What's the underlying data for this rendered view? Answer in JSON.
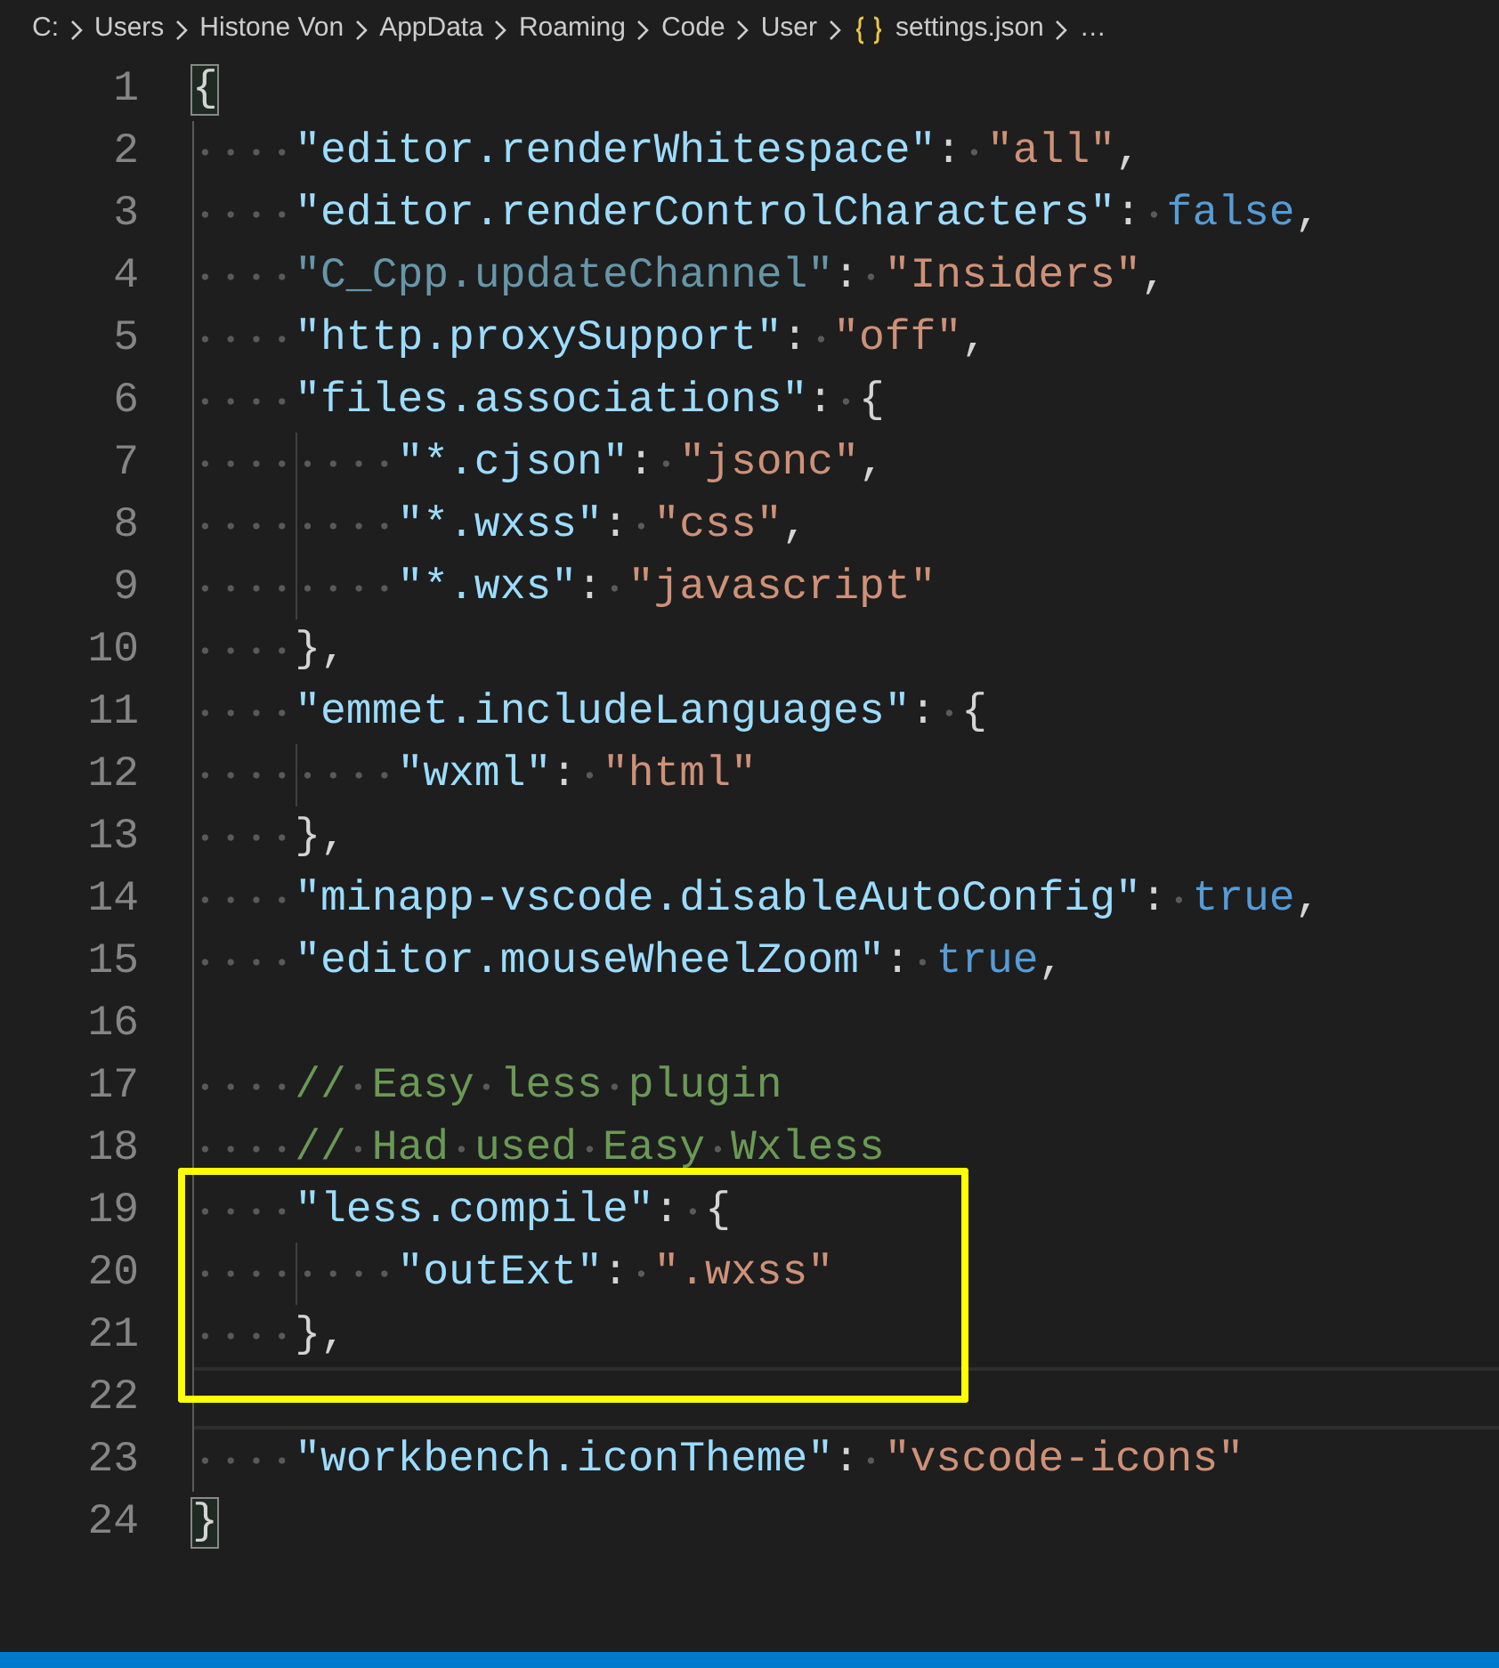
{
  "breadcrumb": [
    {
      "kind": "folder",
      "label": "C:"
    },
    {
      "kind": "folder",
      "label": "Users"
    },
    {
      "kind": "folder",
      "label": "Histone Von"
    },
    {
      "kind": "folder",
      "label": "AppData"
    },
    {
      "kind": "folder",
      "label": "Roaming"
    },
    {
      "kind": "folder",
      "label": "Code"
    },
    {
      "kind": "folder",
      "label": "User"
    },
    {
      "kind": "json_file",
      "label": "settings.json"
    },
    {
      "kind": "more",
      "label": "…"
    }
  ],
  "lines": [
    {
      "number": "1",
      "current": false,
      "boxed": false,
      "tokens": [
        {
          "kind": "bracket_match",
          "text": "{"
        }
      ]
    },
    {
      "number": "2",
      "current": false,
      "boxed": false,
      "tokens": [
        {
          "kind": "key",
          "text": "    \"editor.renderWhitespace\""
        },
        {
          "kind": "plain",
          "text": ": "
        },
        {
          "kind": "string",
          "text": "\"all\""
        },
        {
          "kind": "plain",
          "text": ","
        }
      ]
    },
    {
      "number": "3",
      "current": false,
      "boxed": false,
      "tokens": [
        {
          "kind": "key",
          "text": "    \"editor.renderControlCharacters\""
        },
        {
          "kind": "plain",
          "text": ": "
        },
        {
          "kind": "keyword",
          "text": "false"
        },
        {
          "kind": "plain",
          "text": ","
        }
      ]
    },
    {
      "number": "4",
      "current": false,
      "boxed": false,
      "tokens": [
        {
          "kind": "unknown_key",
          "text": "    \"C_Cpp.updateChannel\""
        },
        {
          "kind": "plain",
          "text": ": "
        },
        {
          "kind": "string",
          "text": "\"Insiders\""
        },
        {
          "kind": "plain",
          "text": ","
        }
      ]
    },
    {
      "number": "5",
      "current": false,
      "boxed": false,
      "tokens": [
        {
          "kind": "key",
          "text": "    \"http.proxySupport\""
        },
        {
          "kind": "plain",
          "text": ": "
        },
        {
          "kind": "string",
          "text": "\"off\""
        },
        {
          "kind": "plain",
          "text": ","
        }
      ]
    },
    {
      "number": "6",
      "current": false,
      "boxed": false,
      "tokens": [
        {
          "kind": "key",
          "text": "    \"files.associations\""
        },
        {
          "kind": "plain",
          "text": ": {"
        }
      ]
    },
    {
      "number": "7",
      "current": false,
      "boxed": false,
      "tokens": [
        {
          "kind": "key",
          "text": "        \"*.cjson\""
        },
        {
          "kind": "plain",
          "text": ": "
        },
        {
          "kind": "string",
          "text": "\"jsonc\""
        },
        {
          "kind": "plain",
          "text": ","
        }
      ]
    },
    {
      "number": "8",
      "current": false,
      "boxed": false,
      "tokens": [
        {
          "kind": "key",
          "text": "        \"*.wxss\""
        },
        {
          "kind": "plain",
          "text": ": "
        },
        {
          "kind": "string",
          "text": "\"css\""
        },
        {
          "kind": "plain",
          "text": ","
        }
      ]
    },
    {
      "number": "9",
      "current": false,
      "boxed": false,
      "tokens": [
        {
          "kind": "key",
          "text": "        \"*.wxs\""
        },
        {
          "kind": "plain",
          "text": ": "
        },
        {
          "kind": "string",
          "text": "\"javascript\""
        }
      ]
    },
    {
      "number": "10",
      "current": false,
      "boxed": false,
      "tokens": [
        {
          "kind": "plain",
          "text": "    },"
        }
      ]
    },
    {
      "number": "11",
      "current": false,
      "boxed": false,
      "tokens": [
        {
          "kind": "key",
          "text": "    \"emmet.includeLanguages\""
        },
        {
          "kind": "plain",
          "text": ": {"
        }
      ]
    },
    {
      "number": "12",
      "current": false,
      "boxed": false,
      "tokens": [
        {
          "kind": "key",
          "text": "        \"wxml\""
        },
        {
          "kind": "plain",
          "text": ": "
        },
        {
          "kind": "string",
          "text": "\"html\""
        }
      ]
    },
    {
      "number": "13",
      "current": false,
      "boxed": false,
      "tokens": [
        {
          "kind": "plain",
          "text": "    },"
        }
      ]
    },
    {
      "number": "14",
      "current": false,
      "boxed": false,
      "tokens": [
        {
          "kind": "key",
          "text": "    \"minapp-vscode.disableAutoConfig\""
        },
        {
          "kind": "plain",
          "text": ": "
        },
        {
          "kind": "keyword",
          "text": "true"
        },
        {
          "kind": "plain",
          "text": ","
        }
      ]
    },
    {
      "number": "15",
      "current": false,
      "boxed": false,
      "tokens": [
        {
          "kind": "key",
          "text": "    \"editor.mouseWheelZoom\""
        },
        {
          "kind": "plain",
          "text": ": "
        },
        {
          "kind": "keyword",
          "text": "true"
        },
        {
          "kind": "plain",
          "text": ","
        }
      ]
    },
    {
      "number": "16",
      "current": false,
      "boxed": false
    },
    {
      "number": "17",
      "current": false,
      "boxed": false,
      "tokens": [
        {
          "kind": "comment",
          "text": "    // Easy less plugin"
        }
      ]
    },
    {
      "number": "18",
      "current": false,
      "boxed": false,
      "tokens": [
        {
          "kind": "comment",
          "text": "    // Had used Easy Wxless"
        }
      ]
    },
    {
      "number": "19",
      "current": false,
      "boxed": true,
      "tokens": [
        {
          "kind": "key",
          "text": "    \"less.compile\""
        },
        {
          "kind": "plain",
          "text": ": {"
        }
      ]
    },
    {
      "number": "20",
      "current": false,
      "boxed": true,
      "tokens": [
        {
          "kind": "key",
          "text": "        \"outExt\""
        },
        {
          "kind": "plain",
          "text": ": "
        },
        {
          "kind": "string",
          "text": "\".wxss\""
        }
      ]
    },
    {
      "number": "21",
      "current": false,
      "boxed": true,
      "tokens": [
        {
          "kind": "plain",
          "text": "    },"
        }
      ]
    },
    {
      "number": "22",
      "current": true,
      "boxed": true
    },
    {
      "number": "23",
      "current": false,
      "boxed": false,
      "tokens": [
        {
          "kind": "key",
          "text": "    \"workbench.iconTheme\""
        },
        {
          "kind": "plain",
          "text": ": "
        },
        {
          "kind": "string",
          "text": "\"vscode-icons\""
        }
      ]
    },
    {
      "number": "24",
      "current": false,
      "boxed": false,
      "tokens": [
        {
          "kind": "bracket_match",
          "text": "}"
        }
      ]
    }
  ]
}
